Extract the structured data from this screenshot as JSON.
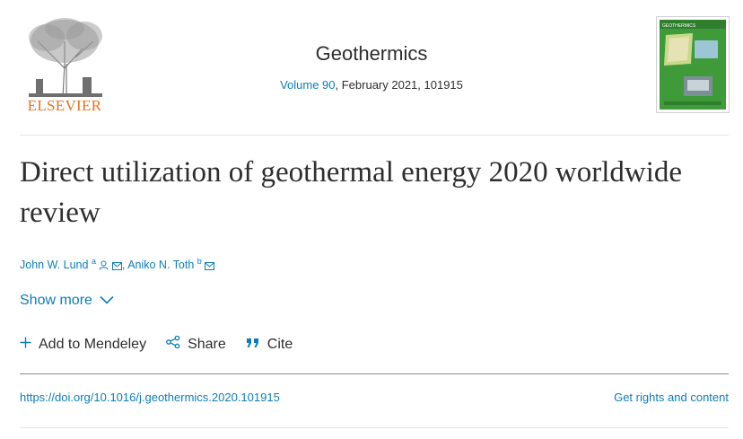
{
  "publisher": {
    "name": "ELSEVIER"
  },
  "journal": {
    "title": "Geothermics",
    "volume_link": "Volume 90",
    "issue_info": ", February 2021, 101915"
  },
  "article": {
    "title": "Direct utilization of geothermal energy 2020 worldwide review"
  },
  "authors": [
    {
      "name": "John W. Lund",
      "affiliation": "a"
    },
    {
      "name": "Aniko N. Toth",
      "affiliation": "b"
    }
  ],
  "author_separator": ", ",
  "show_more": {
    "label": "Show more"
  },
  "actions": {
    "mendeley": "Add to Mendeley",
    "share": "Share",
    "cite": "Cite"
  },
  "doi": "https://doi.org/10.1016/j.geothermics.2020.101915",
  "rights": "Get rights and content",
  "colors": {
    "link": "#0c7dbb",
    "elsevier_orange": "#e9711c",
    "cover_green": "#3f9a3a"
  },
  "icons": [
    "elsevier-tree-logo",
    "person-icon",
    "mail-icon",
    "chevron-down-icon",
    "plus-icon",
    "share-icon",
    "quote-icon"
  ]
}
